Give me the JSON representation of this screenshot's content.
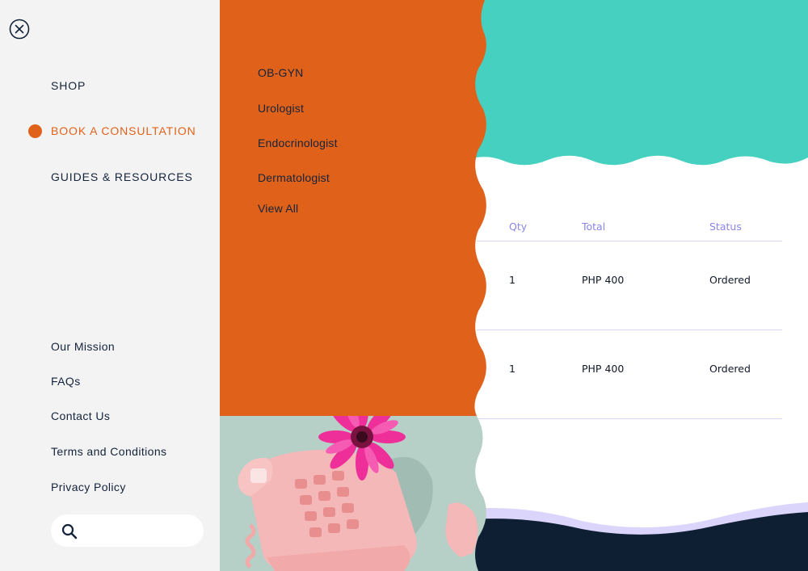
{
  "nav": {
    "close_icon": "close-circle-icon",
    "items": [
      {
        "label": "SHOP"
      },
      {
        "label": "BOOK A CONSULTATION",
        "active": true
      },
      {
        "label": "GUIDES & RESOURCES"
      }
    ],
    "footer_links": [
      {
        "label": "Our Mission"
      },
      {
        "label": "FAQs"
      },
      {
        "label": "Contact Us"
      },
      {
        "label": "Terms and Conditions"
      },
      {
        "label": "Privacy Policy"
      }
    ],
    "search": {
      "icon": "search-icon",
      "placeholder": "",
      "value": ""
    }
  },
  "submenu": {
    "items": [
      {
        "label": "OB-GYN"
      },
      {
        "label": "Urologist"
      },
      {
        "label": "Endocrinologist"
      },
      {
        "label": "Dermatologist"
      },
      {
        "label": "View All"
      }
    ]
  },
  "orders": {
    "columns": [
      "Qty",
      "Total",
      "Status"
    ],
    "rows": [
      {
        "qty": "1",
        "total": "PHP 400",
        "status": "Ordered"
      },
      {
        "qty": "1",
        "total": "PHP 400",
        "status": "Ordered"
      }
    ]
  },
  "colors": {
    "accent": "#e0621a",
    "teal": "#46d0c0",
    "navy": "#0e1e33",
    "lavender": "#dcd5fb",
    "nav_bg": "#f3f3f4"
  }
}
